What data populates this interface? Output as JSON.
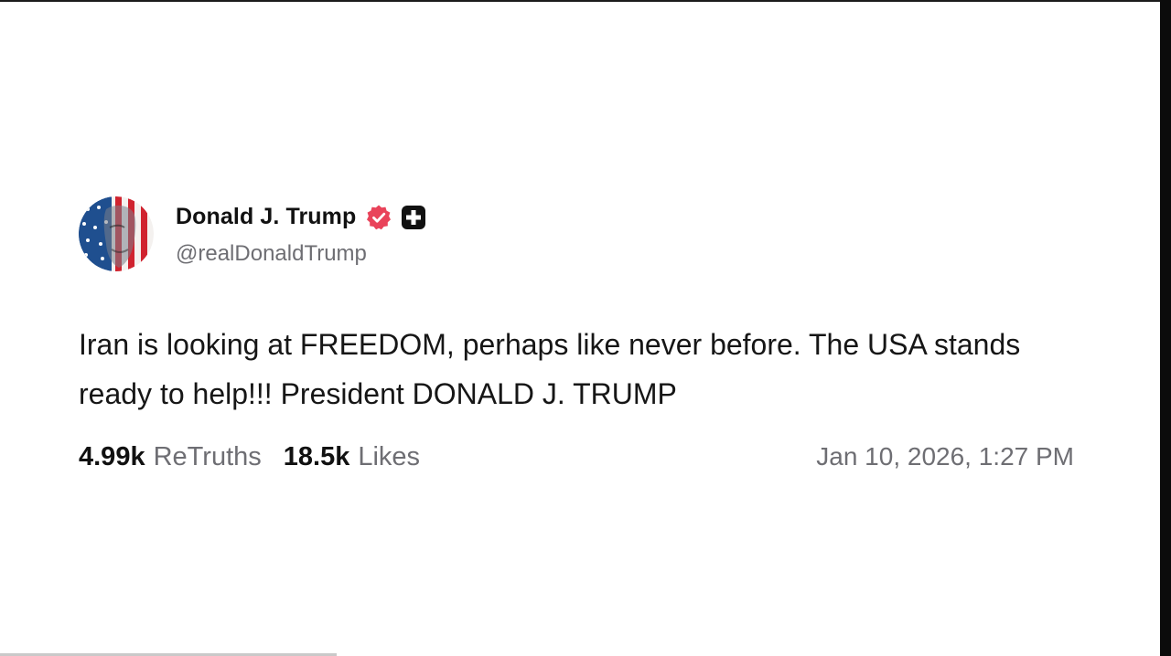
{
  "post": {
    "author": {
      "display_name": "Donald J. Trump",
      "handle": "@realDonaldTrump",
      "avatar_icon": "flag-portrait-avatar",
      "verified_icon": "verified-badge-icon",
      "extra_badge_icon": "plus-badge-icon"
    },
    "text": "Iran is looking at FREEDOM, perhaps like never before. The USA stands ready to help!!! President DONALD J. TRUMP",
    "stats": {
      "retruths_count": "4.99k",
      "retruths_label": "ReTruths",
      "likes_count": "18.5k",
      "likes_label": "Likes"
    },
    "timestamp": "Jan 10, 2026, 1:27 PM"
  },
  "colors": {
    "background": "#ffffff",
    "text": "#111111",
    "muted_text": "#6e6e73",
    "verified_badge": "#e9435a",
    "plus_badge": "#111111"
  }
}
